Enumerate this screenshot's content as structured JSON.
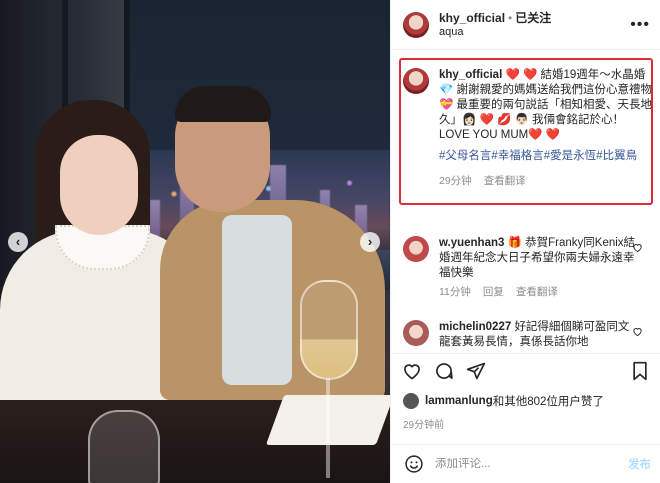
{
  "header": {
    "username": "khy_official",
    "separator": "•",
    "follow_status": "已关注",
    "location": "aqua",
    "more_icon": "more-horizontal-icon"
  },
  "caption": {
    "username": "khy_official",
    "text": "❤️ ❤️ 結婚19週年～水晶婚💎 謝謝親愛的媽媽送給我們這份心意禮物💝 最重要的兩句説話「相知相愛、天長地久」👩🏻 ❤️ 💋 👨🏻 我倆會銘記於心！LOVE YOU MUM❤️ ❤️",
    "hashtags": "#父母名言#幸福格言#愛是永恆#比翼鳥",
    "time": "29分钟",
    "translate": "查看翻译"
  },
  "comments": [
    {
      "username": "w.yuenhan3",
      "text": "🎁 恭賀Franky同Kenix結婚週年紀念大日子希望你兩夫婦永遠幸福快樂",
      "time": "11分钟",
      "reply": "回复",
      "translate": "查看翻译"
    },
    {
      "username": "michelin0227",
      "text": "好記得細個睇可盈同文龍套黃易長情，真係長話你地"
    }
  ],
  "likes": {
    "text_bold": "lammanlung",
    "text_rest": "和其他802位用户赞了"
  },
  "post_time": "29分钟前",
  "add_comment": {
    "placeholder": "添加评论...",
    "post_label": "发布"
  },
  "icons": {
    "like": "heart-icon",
    "comment": "comment-icon",
    "share": "send-icon",
    "save": "bookmark-icon",
    "emoji": "emoji-icon"
  },
  "colors": {
    "highlight_border": "#e02a3a",
    "hashtag": "#385898",
    "muted": "#8e8e8e",
    "post_button": "#b2dffc"
  }
}
